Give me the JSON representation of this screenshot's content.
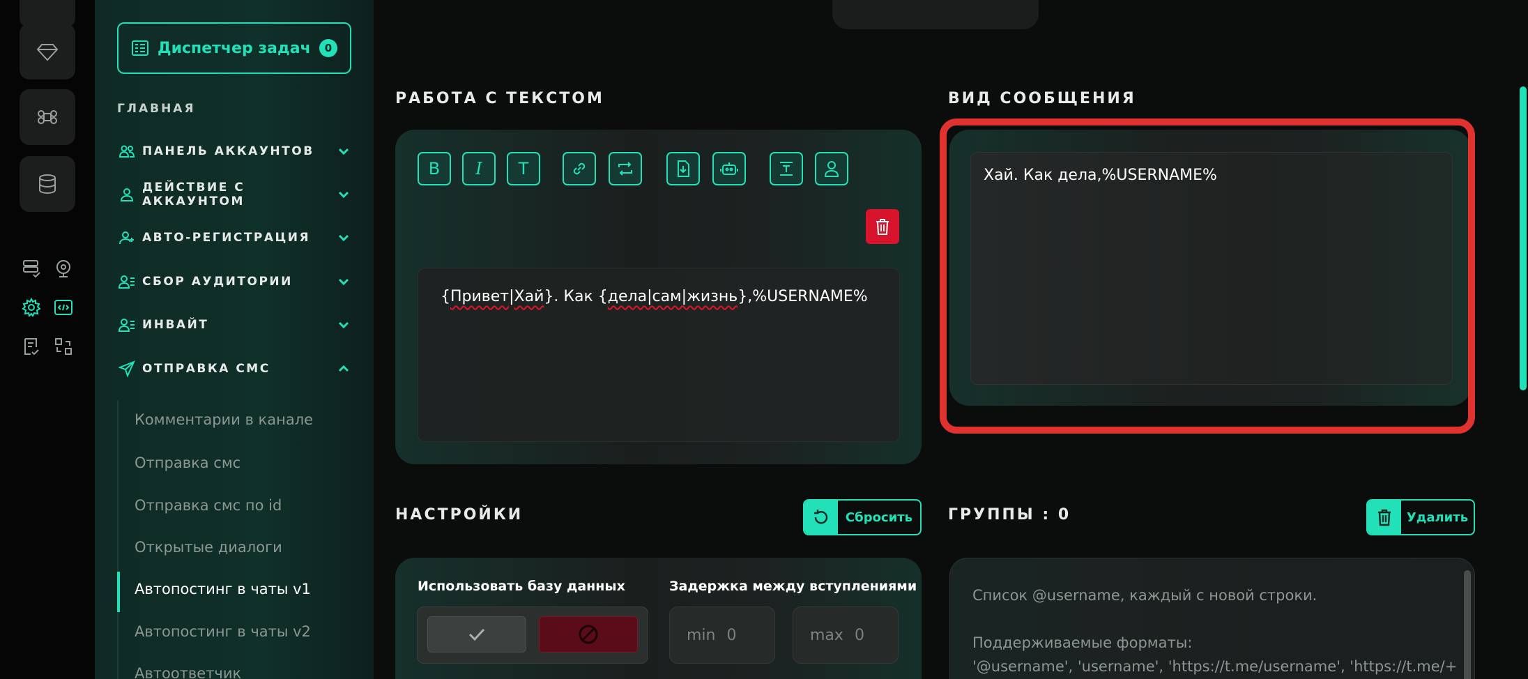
{
  "sidebar": {
    "task_button": {
      "label": "Диспетчер задач",
      "count": "0"
    },
    "section_title": "ГЛАВНАЯ",
    "items": [
      {
        "label": "ПАНЕЛЬ АККАУНТОВ",
        "icon": "users-icon"
      },
      {
        "label": "ДЕЙСТВИЕ С АККАУНТОМ",
        "icon": "user-icon"
      },
      {
        "label": "АВТО-РЕГИСТРАЦИЯ",
        "icon": "user-plus-icon"
      },
      {
        "label": "СБОР АУДИТОРИИ",
        "icon": "user-list-icon"
      },
      {
        "label": "ИНВАЙТ",
        "icon": "user-list-icon"
      },
      {
        "label": "ОТПРАВКА СМС",
        "icon": "send-icon"
      }
    ],
    "subitems": [
      "Комментарии в канале",
      "Отправка смс",
      "Отправка смс по id",
      "Открытые диалоги",
      "Автопостинг в чаты v1",
      "Автопостинг в чаты v2",
      "Автоответчик"
    ],
    "active_subitem": "Автопостинг в чаты v1"
  },
  "text_work": {
    "title": "РАБОТА С ТЕКСТОМ",
    "tools": [
      {
        "name": "bold-button",
        "glyph": "B"
      },
      {
        "name": "italic-button",
        "glyph": "I"
      },
      {
        "name": "text-button",
        "glyph": "T"
      },
      {
        "name": "link-button",
        "icon": "link-icon"
      },
      {
        "name": "repeat-button",
        "icon": "repeat-icon"
      },
      {
        "name": "import-file-button",
        "icon": "file-download-icon"
      },
      {
        "name": "bot-button",
        "icon": "bot-icon"
      },
      {
        "name": "text-format-button",
        "icon": "text-block-icon"
      },
      {
        "name": "username-button",
        "icon": "person-icon"
      }
    ],
    "content": {
      "part1": "{",
      "word1": "Привет",
      "part2": "|",
      "word2": "Хай",
      "part3": "}. Как {",
      "word3": "дела|сам|жизнь",
      "part4": "},%USERNAME%"
    }
  },
  "preview": {
    "title": "ВИД СООБЩЕНИЯ",
    "text": "Хай. Как дела,%USERNAME%"
  },
  "settings": {
    "title": "НАСТРОЙКИ",
    "reset_label": "Сбросить",
    "use_db_label": "Использовать базу данных",
    "delay_label": "Задержка между вступлениями",
    "min_label": "min",
    "min_value": "0",
    "max_label": "max",
    "max_value": "0"
  },
  "groups": {
    "title": "ГРУППЫ : 0",
    "delete_label": "Удалить",
    "placeholder_line1": "Список @username, каждый с новой строки.",
    "placeholder_line2": "Поддерживаемые форматы:",
    "placeholder_line3": "'@username', 'username', 'https://t.me/username', 'https://t.me/+"
  },
  "colors": {
    "accent": "#22e0b8",
    "danger": "#d8142d",
    "highlight": "#e0322f",
    "background": "#0b0c0c"
  }
}
